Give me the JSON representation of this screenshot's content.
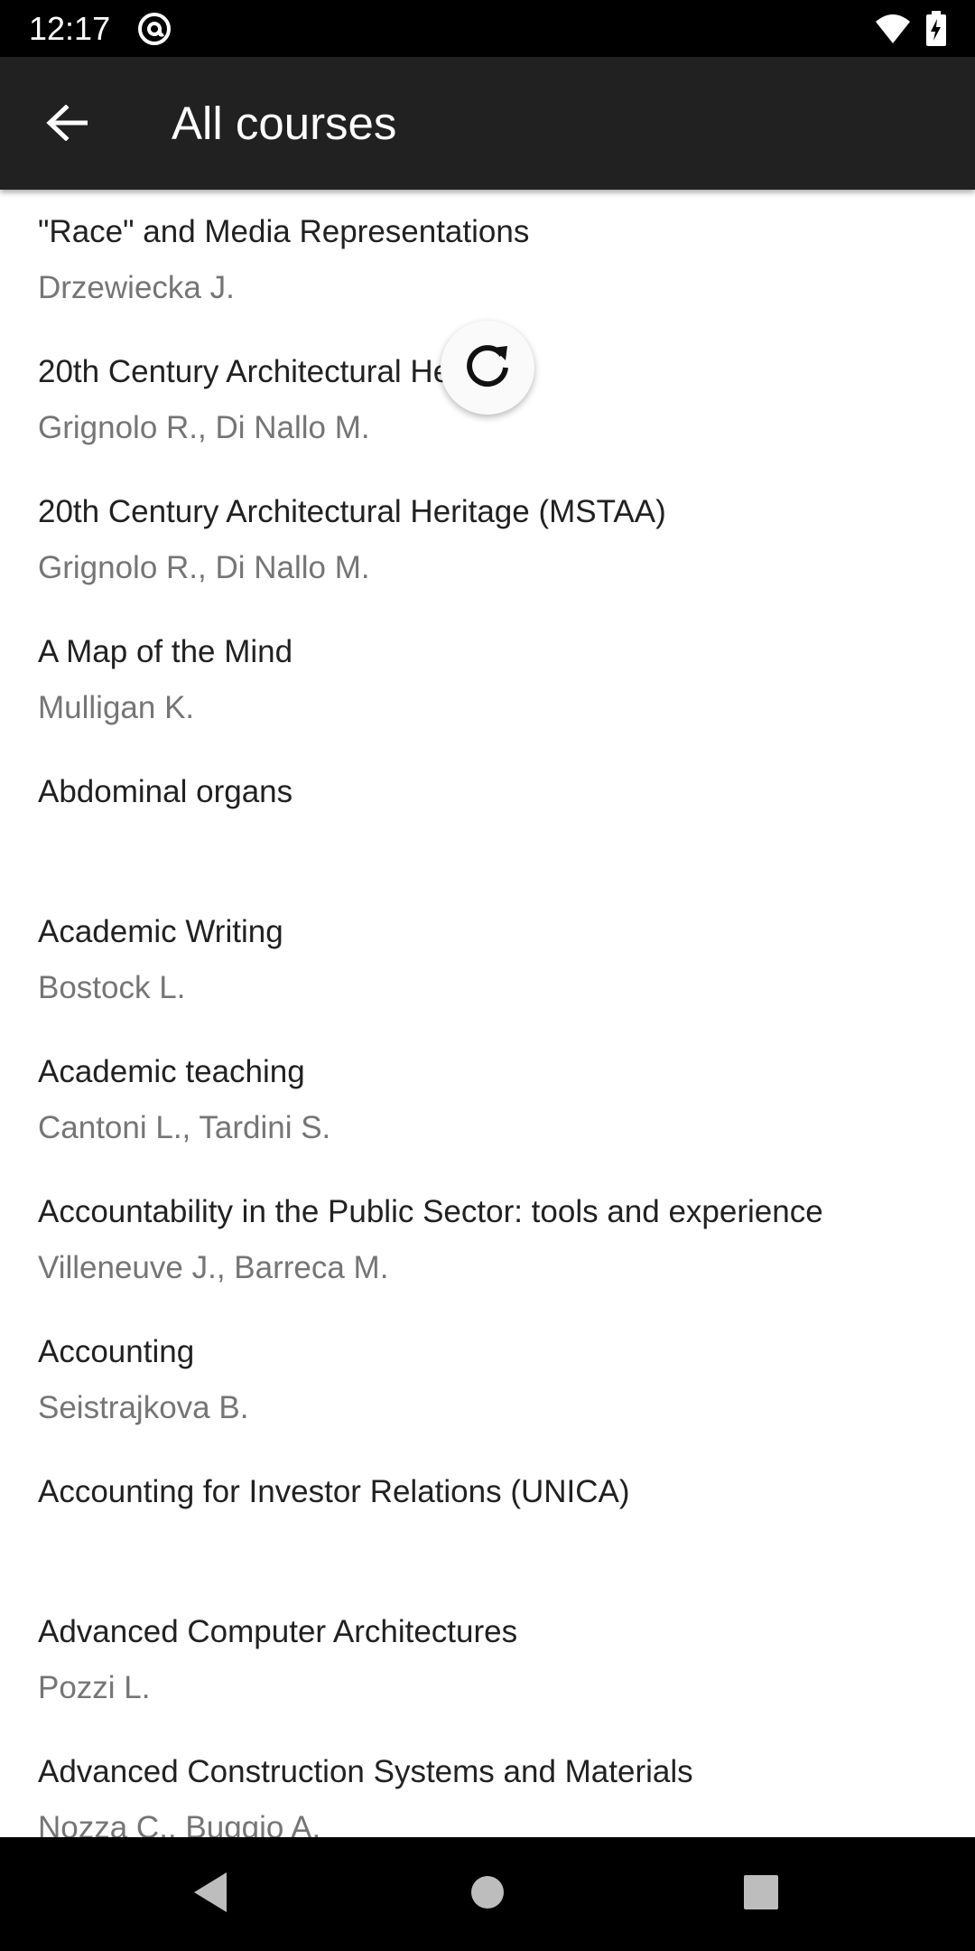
{
  "status_bar": {
    "time": "12:17",
    "icons": [
      "at-sign-icon",
      "wifi-icon",
      "battery-charging-icon"
    ],
    "wifi_label": "4"
  },
  "app_bar": {
    "back_icon": "arrow-back-icon",
    "title": "All courses"
  },
  "courses": [
    {
      "title": "\"Race\" and Media Representations",
      "teachers": "Drzewiecka J."
    },
    {
      "title": "20th Century Architectural Heritage",
      "teachers": "Grignolo R., Di Nallo M."
    },
    {
      "title": "20th Century Architectural Heritage (MSTAA)",
      "teachers": "Grignolo R., Di Nallo M."
    },
    {
      "title": "A Map of the Mind",
      "teachers": "Mulligan K."
    },
    {
      "title": "Abdominal organs",
      "teachers": ""
    },
    {
      "title": "Academic Writing",
      "teachers": "Bostock L."
    },
    {
      "title": "Academic teaching",
      "teachers": "Cantoni L., Tardini S."
    },
    {
      "title": "Accountability in the Public Sector: tools and experience",
      "teachers": "Villeneuve J., Barreca M."
    },
    {
      "title": "Accounting",
      "teachers": "Seistrajkova B."
    },
    {
      "title": "Accounting for Investor Relations (UNICA)",
      "teachers": ""
    },
    {
      "title": "Advanced Computer Architectures",
      "teachers": "Pozzi L."
    },
    {
      "title": "Advanced Construction Systems and Materials",
      "teachers": "Nozza C., Buggio A."
    }
  ],
  "refresh_indicator": {
    "icon": "refresh-icon"
  },
  "nav_bar": {
    "icons": [
      "nav-back-icon",
      "nav-home-icon",
      "nav-recents-icon"
    ]
  },
  "colors": {
    "status_bar": "#000000",
    "app_bar": "#212121",
    "title_text": "#212121",
    "secondary_text": "#757575",
    "background": "#ffffff"
  }
}
